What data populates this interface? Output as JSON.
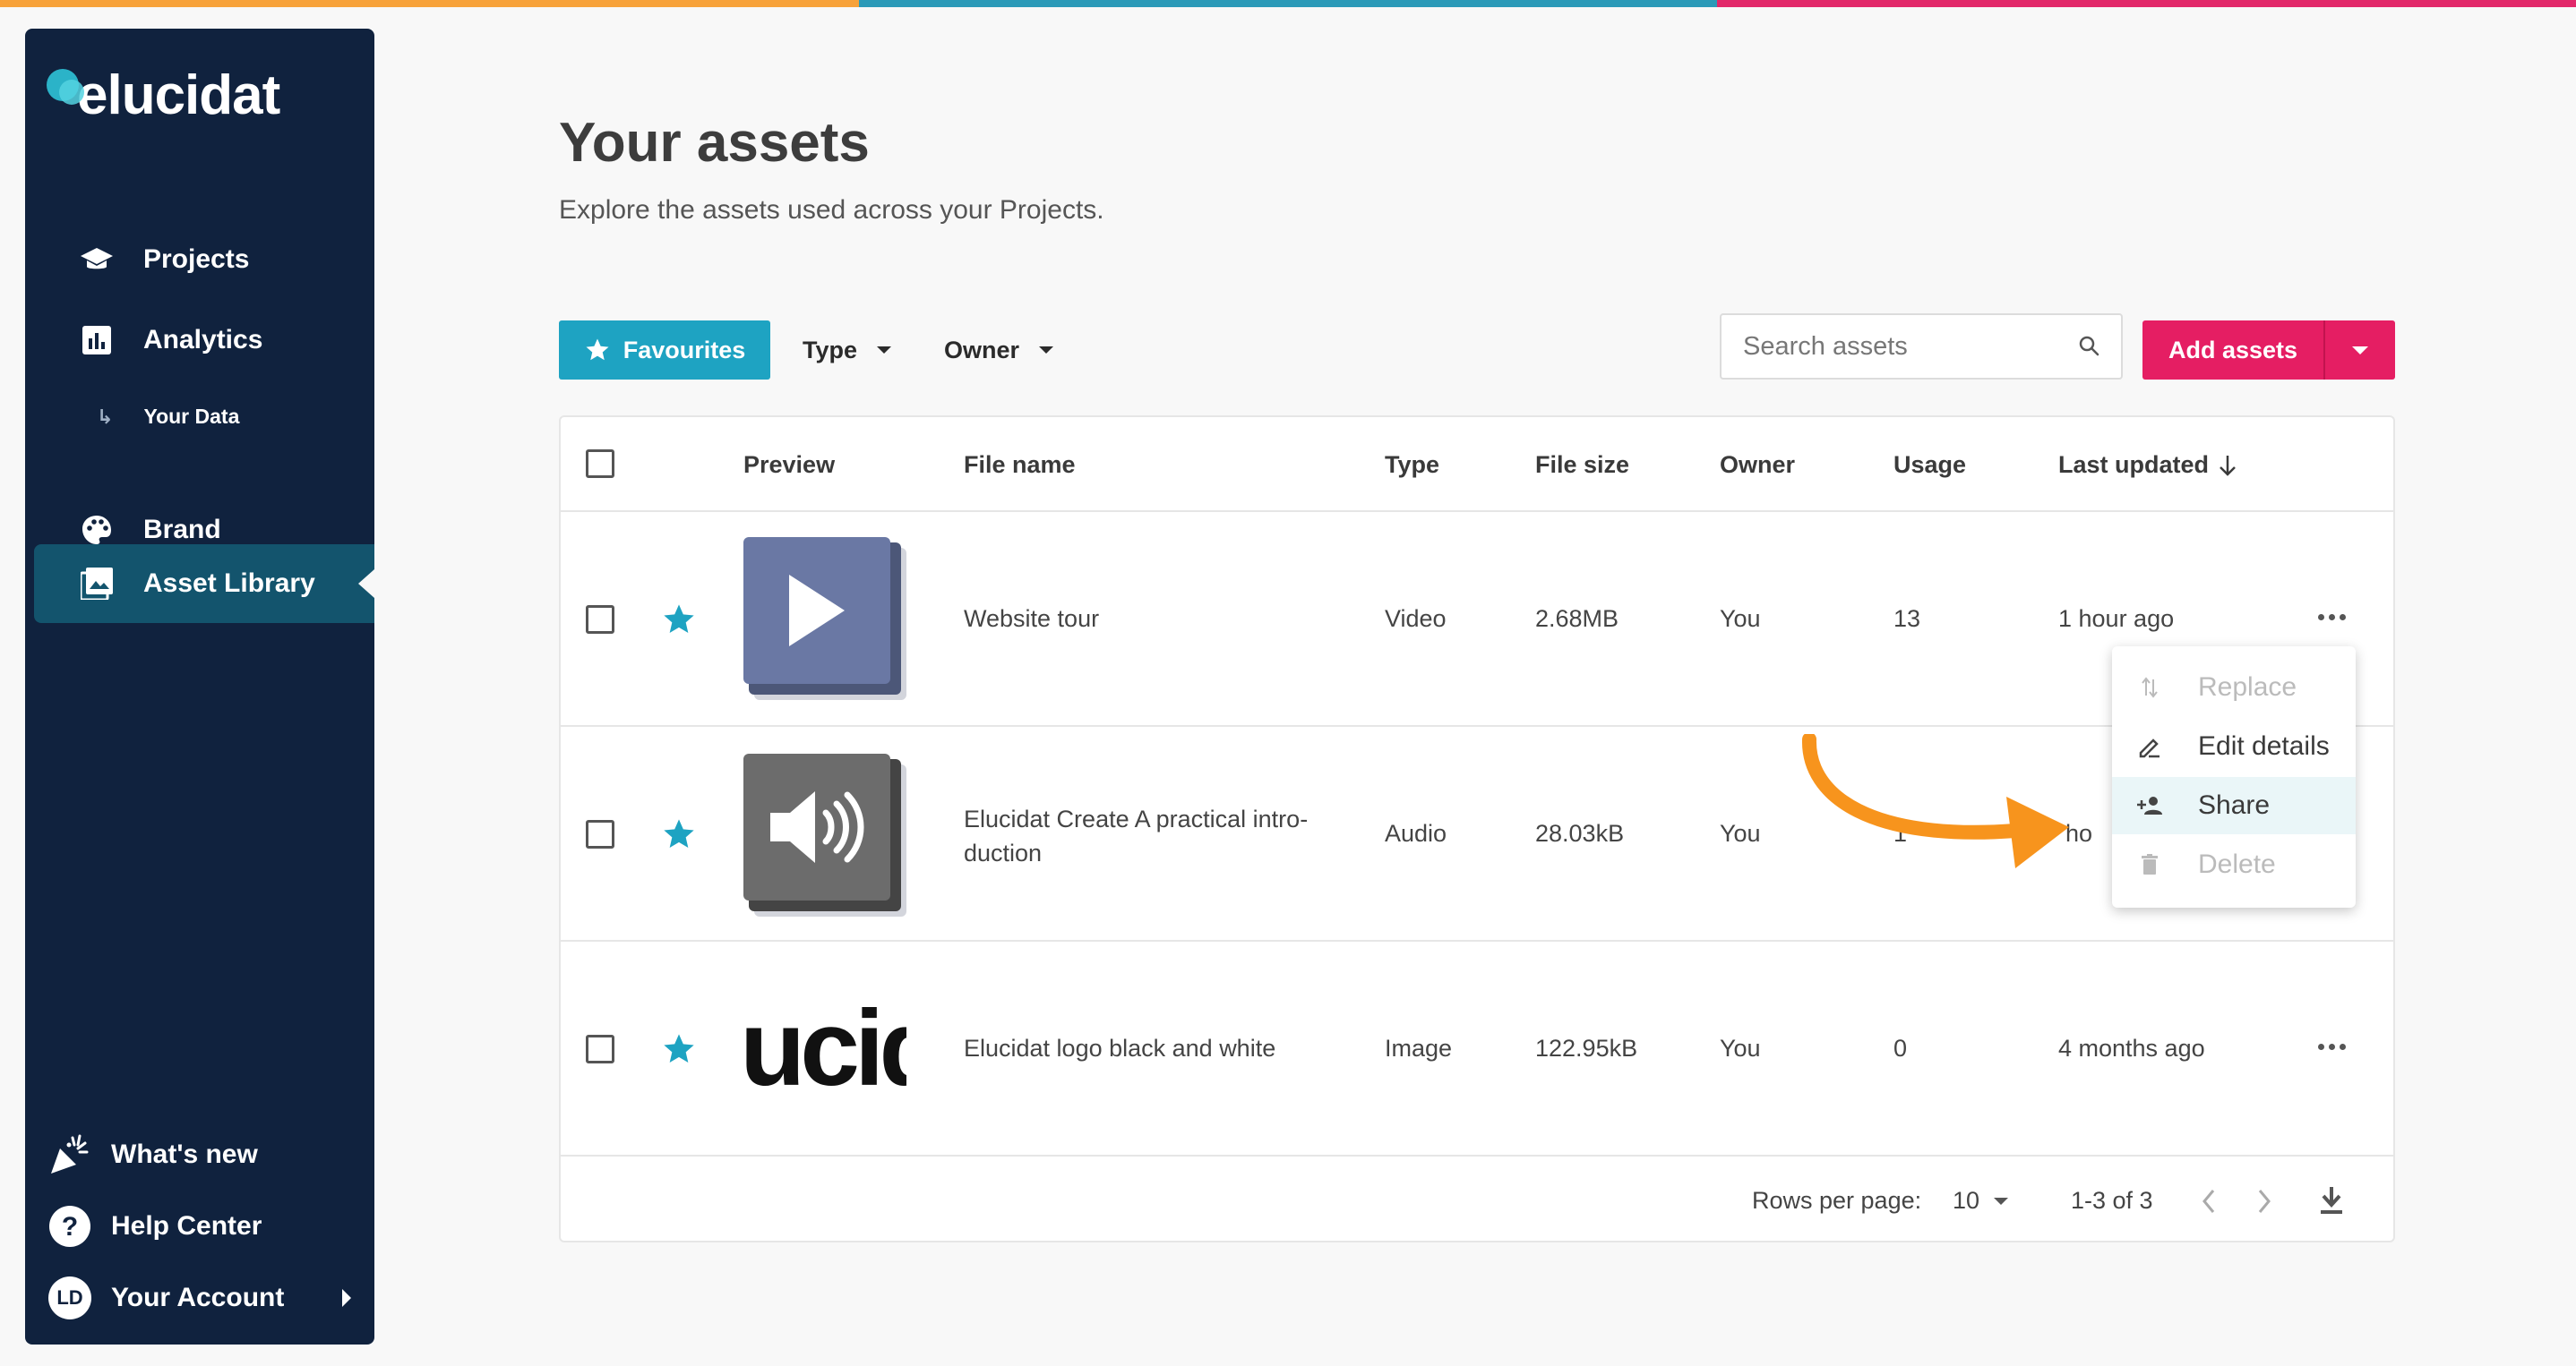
{
  "colors": {
    "sidebar_bg": "#10223e",
    "accent_teal": "#1ea3c2",
    "accent_pink": "#e51e63",
    "annotation_arrow": "#f7941d"
  },
  "brand": {
    "logo_text": "elucidat"
  },
  "sidebar": {
    "items": [
      {
        "label": "Projects",
        "icon": "graduation-cap-icon"
      },
      {
        "label": "Analytics",
        "icon": "bar-chart-icon"
      },
      {
        "label": "Your Data",
        "icon": "sub-arrow-icon"
      },
      {
        "label": "Brand",
        "icon": "palette-icon"
      },
      {
        "label": "Asset Library",
        "icon": "image-library-icon",
        "active": true
      }
    ],
    "bottom": [
      {
        "label": "What's new",
        "icon": "party-popper-icon"
      },
      {
        "label": "Help Center",
        "icon": "help-circle-icon"
      },
      {
        "label": "Your Account",
        "avatar": "LD"
      }
    ]
  },
  "header": {
    "title": "Your assets",
    "subtitle": "Explore the assets used across your Projects."
  },
  "toolbar": {
    "favourites": "Favourites",
    "type_filter": "Type",
    "owner_filter": "Owner",
    "search_placeholder": "Search assets",
    "add_assets": "Add assets"
  },
  "table": {
    "columns": [
      "Preview",
      "File name",
      "Type",
      "File size",
      "Owner",
      "Usage",
      "Last updated"
    ],
    "rows": [
      {
        "file_name": "Website tour",
        "type": "Video",
        "size": "2.68MB",
        "owner": "You",
        "usage": "13",
        "updated": "1 hour ago",
        "favourite": true
      },
      {
        "file_name": "Elucidat Create A practical intro-duction",
        "file_name_l1": "Elucidat Create A practical intro-",
        "file_name_l2": "duction",
        "type": "Audio",
        "size": "28.03kB",
        "owner": "You",
        "usage": "1",
        "updated": "ho",
        "favourite": true
      },
      {
        "file_name": "Elucidat logo black and white",
        "type": "Image",
        "size": "122.95kB",
        "owner": "You",
        "usage": "0",
        "updated": "4 months ago",
        "favourite": true,
        "preview_text": "ucid"
      }
    ],
    "footer": {
      "rows_per_page_label": "Rows per page:",
      "rows_per_page_value": "10",
      "range": "1-3 of 3"
    }
  },
  "context_menu": {
    "items": [
      {
        "label": "Replace",
        "disabled": true
      },
      {
        "label": "Edit details",
        "disabled": false
      },
      {
        "label": "Share",
        "disabled": false,
        "highlighted": true
      },
      {
        "label": "Delete",
        "disabled": true
      }
    ]
  }
}
